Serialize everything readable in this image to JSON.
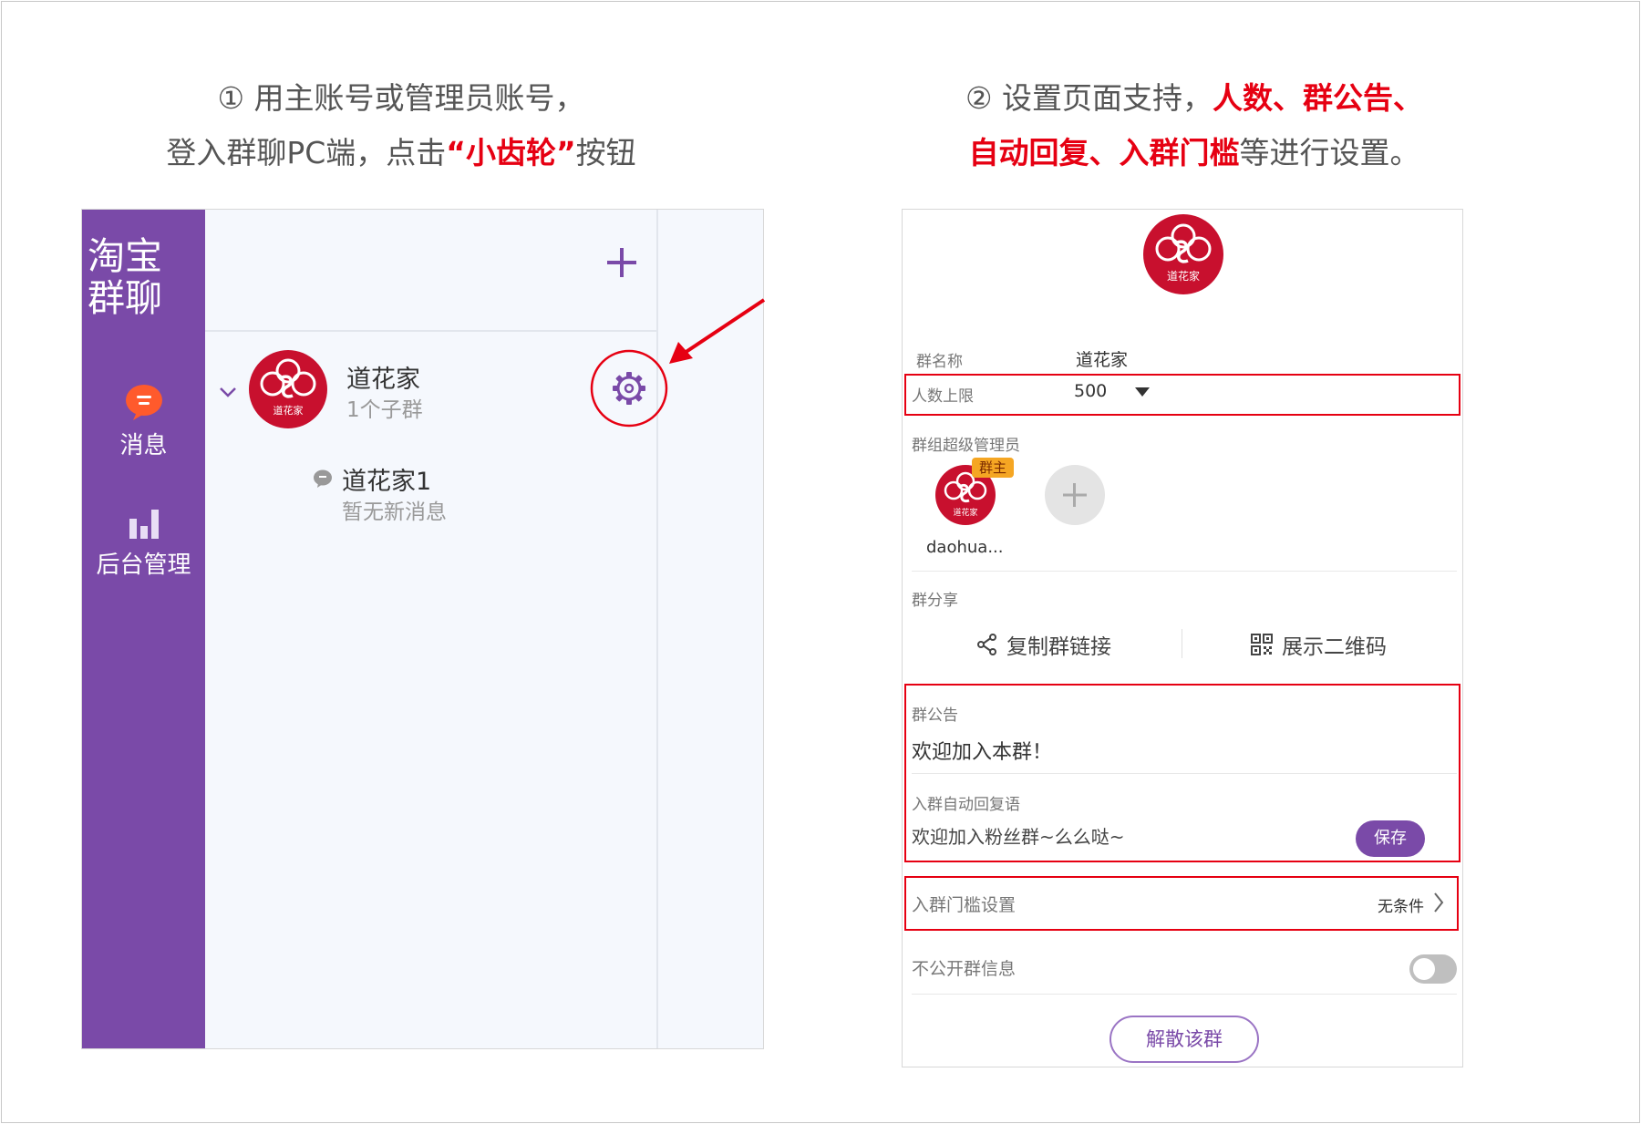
{
  "captions": {
    "step1_line1": "① 用主账号或管理员账号，",
    "step1_line2_a": "登入群聊PC端，点击",
    "step1_line2_b": "“小齿轮”",
    "step1_line2_c": "按钮",
    "step2_line1_a": "② 设置页面支持，",
    "step2_line1_b": "人数、群公告、",
    "step2_line2_a": "自动回复、入群门槛",
    "step2_line2_b": "等进行设置。"
  },
  "left_app": {
    "logo_line1": "淘宝",
    "logo_line2": "群聊",
    "nav": [
      {
        "label": "消息",
        "icon": "chat-bubble-icon"
      },
      {
        "label": "后台管理",
        "icon": "bar-chart-icon"
      }
    ],
    "group": {
      "name": "道花家",
      "sub": "1个子群",
      "avatar_text": "道花家"
    },
    "subgroup": {
      "name": "道花家1",
      "last_message": "暂无新消息"
    }
  },
  "settings": {
    "logo_text": "道花家",
    "group_name_label": "群名称",
    "group_name_value": "道花家",
    "member_limit_label": "人数上限",
    "member_limit_value": "500",
    "admins_label": "群组超级管理员",
    "owner_badge": "群主",
    "admin_avatar_text": "道花家",
    "admin_name": "daohua...",
    "share_label": "群分享",
    "copy_link": "复制群链接",
    "show_qr": "展示二维码",
    "notice_label": "群公告",
    "notice_value": "欢迎加入本群！",
    "auto_reply_label": "入群自动回复语",
    "auto_reply_value": "欢迎加入粉丝群~么么哒~",
    "save_label": "保存",
    "threshold_label": "入群门槛设置",
    "threshold_value": "无条件",
    "private_label": "不公开群信息",
    "dismiss_label": "解散该群"
  },
  "colors": {
    "brand_purple": "#7a4aa8",
    "highlight_red": "#e60012",
    "logo_red": "#c8102e"
  }
}
